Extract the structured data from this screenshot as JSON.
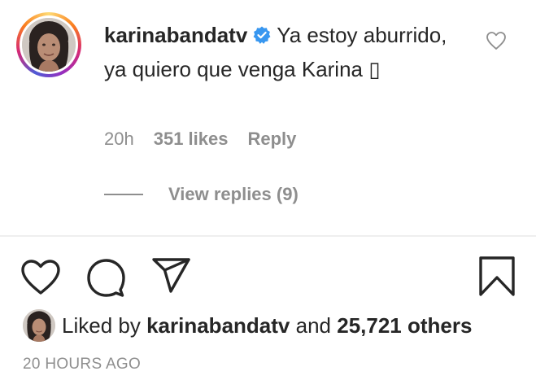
{
  "comment": {
    "username": "karinabandatv",
    "verified_icon": "verified-badge-icon",
    "text": "Ya estoy aburrido, ya quiero que venga Karina ▯",
    "time_ago": "20h",
    "likes": "351 likes",
    "reply_label": "Reply",
    "view_replies": "View replies (9)",
    "like_icon": "heart-outline-icon"
  },
  "actions": {
    "like_icon": "heart-icon",
    "comment_icon": "comment-icon",
    "share_icon": "send-icon",
    "save_icon": "bookmark-icon"
  },
  "liked_by": {
    "prefix": "Liked by",
    "user": "karinabandatv",
    "connector": "and",
    "others": "25,721 others"
  },
  "post_time": "20 HOURS AGO",
  "colors": {
    "text": "#262626",
    "muted": "#8e8e8e",
    "verified": "#3897f0",
    "divider": "#efefef"
  }
}
